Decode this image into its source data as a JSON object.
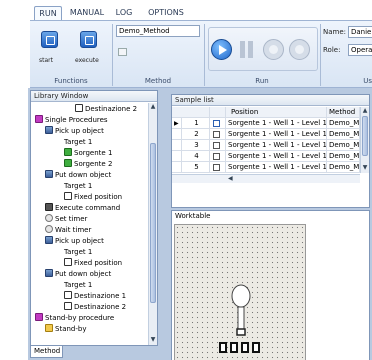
{
  "tabs": [
    "RUN",
    "MANUAL",
    "LOG",
    "OPTIONS"
  ],
  "ribbon": {
    "start_label": "start",
    "execute_label": "execute",
    "method_value": "Demo_Method",
    "name_label": "Name:",
    "name_value": "Danie",
    "role_label": "Role:",
    "role_value": "Opera",
    "groups": [
      "Functions",
      "Method",
      "Run",
      "Us"
    ]
  },
  "library": {
    "title": "Library Window",
    "items": [
      {
        "label": "Destinazione 2",
        "icon": "target-icon"
      },
      {
        "label": "Single Procedures",
        "icon": "procedure-icon"
      },
      {
        "label": "Pick up object",
        "icon": "pick-icon"
      },
      {
        "label": "Target 1",
        "icon": "none"
      },
      {
        "label": "Sorgente 1",
        "icon": "target-icon"
      },
      {
        "label": "Sorgente 2",
        "icon": "target-icon"
      },
      {
        "label": "Put down object",
        "icon": "put-icon"
      },
      {
        "label": "Target 1",
        "icon": "none"
      },
      {
        "label": "Fixed position",
        "icon": "target-icon"
      },
      {
        "label": "Execute command",
        "icon": "command-icon"
      },
      {
        "label": "Set timer",
        "icon": "timer-icon"
      },
      {
        "label": "Wait timer",
        "icon": "timer-icon"
      },
      {
        "label": "Pick up object",
        "icon": "pick-icon"
      },
      {
        "label": "Target 1",
        "icon": "none"
      },
      {
        "label": "Fixed position",
        "icon": "target-icon"
      },
      {
        "label": "Put down object",
        "icon": "put-icon"
      },
      {
        "label": "Target 1",
        "icon": "none"
      },
      {
        "label": "Destinazione 1",
        "icon": "target-icon"
      },
      {
        "label": "Destinazione 2",
        "icon": "target-icon"
      },
      {
        "label": "Stand-by procedure",
        "icon": "procedure-icon"
      },
      {
        "label": "Stand-by",
        "icon": "standby-icon"
      }
    ],
    "bottom_tab": "Method"
  },
  "sample_list": {
    "title": "Sample list",
    "columns": [
      "Position",
      "Method"
    ],
    "rows": [
      {
        "num": "1",
        "position": "Sorgente 1 - Well 1 - Level 15",
        "method": "Demo_Me"
      },
      {
        "num": "2",
        "position": "Sorgente 1 - Well 1 - Level 14",
        "method": "Demo_Me"
      },
      {
        "num": "3",
        "position": "Sorgente 1 - Well 1 - Level 13",
        "method": "Demo_Me"
      },
      {
        "num": "4",
        "position": "Sorgente 1 - Well 1 - Level 12",
        "method": "Demo_Me"
      },
      {
        "num": "5",
        "position": "Sorgente 1 - Well 1 - Level 11",
        "method": "Demo_Me"
      }
    ]
  },
  "worktable": {
    "title": "Worktable"
  }
}
